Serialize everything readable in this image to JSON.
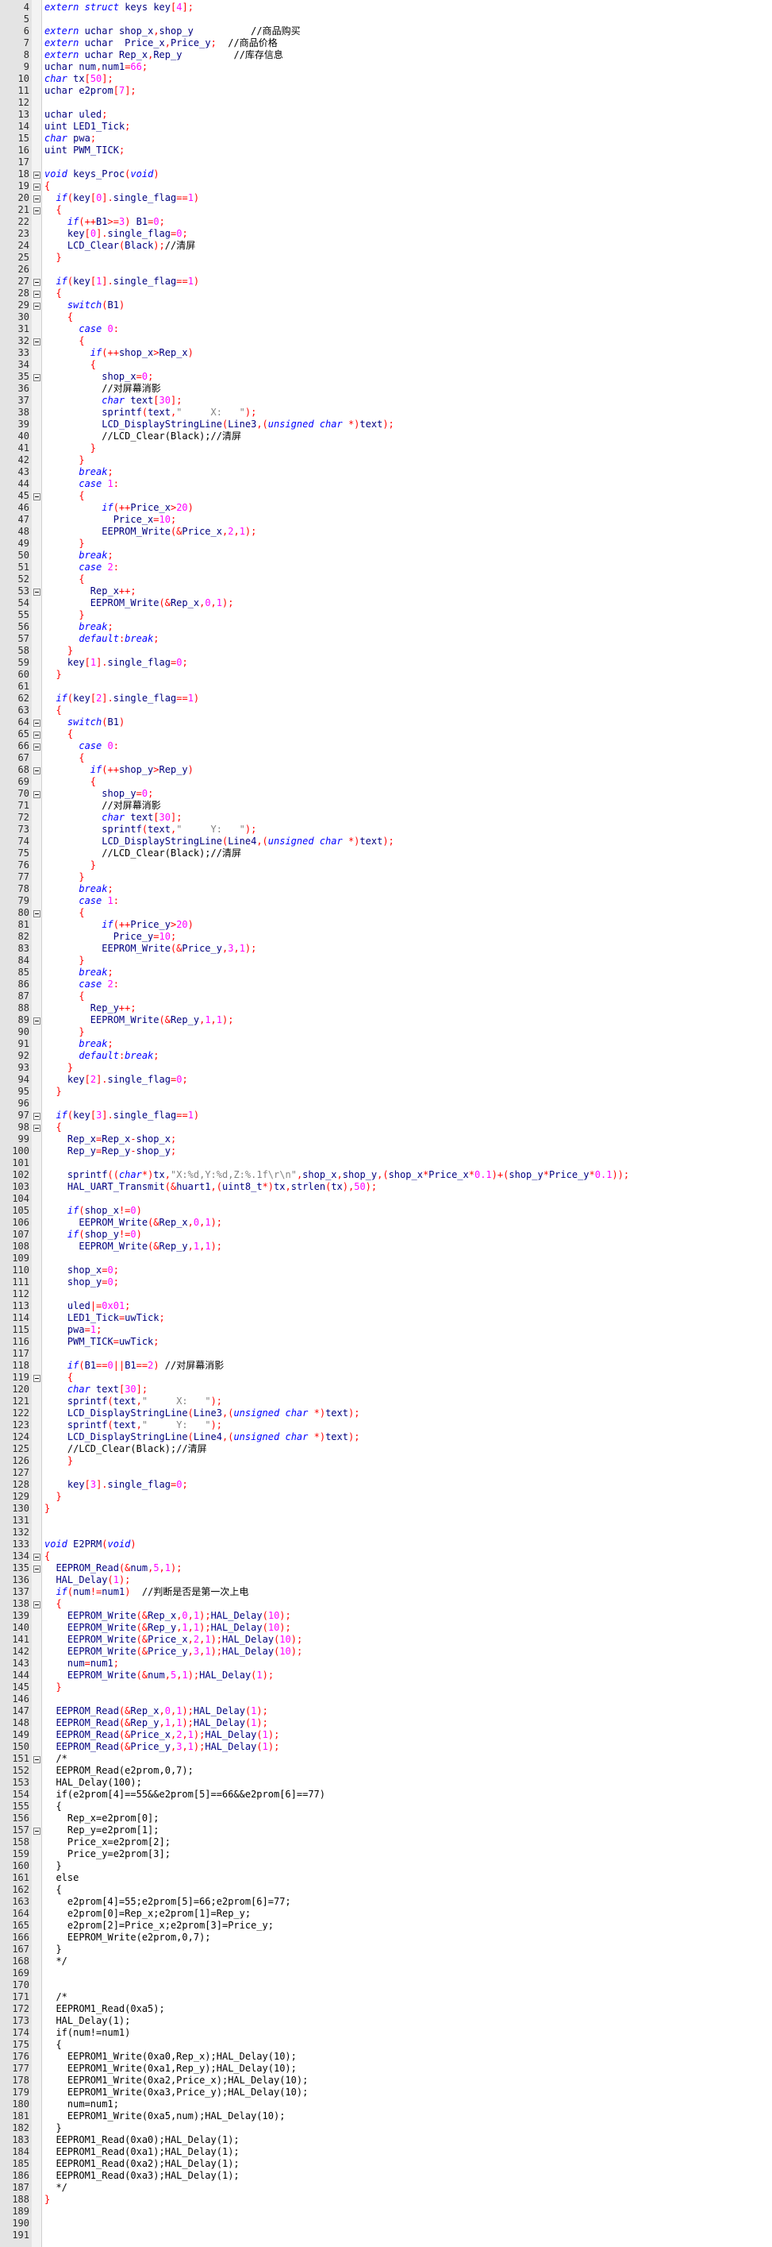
{
  "window": {
    "title": ""
  },
  "editor": {
    "first_line_number": 4,
    "last_line_number": 191,
    "fold_marker_lines": [
      18,
      19,
      20,
      21,
      27,
      28,
      29,
      32,
      35,
      45,
      53,
      64,
      65,
      66,
      68,
      70,
      80,
      89,
      97,
      98,
      119,
      134,
      135,
      138,
      151,
      157
    ]
  },
  "code_lines": [
    {
      "n": 4,
      "t": "extern struct keys key[4];"
    },
    {
      "n": 5,
      "t": ""
    },
    {
      "n": 6,
      "t": "extern uchar shop_x,shop_y          //商品购买"
    },
    {
      "n": 7,
      "t": "extern uchar  Price_x,Price_y;  //商品价格"
    },
    {
      "n": 8,
      "t": "extern uchar Rep_x,Rep_y         //库存信息"
    },
    {
      "n": 9,
      "t": "uchar num,num1=66;"
    },
    {
      "n": 10,
      "t": "char tx[50];"
    },
    {
      "n": 11,
      "t": "uchar e2prom[7];"
    },
    {
      "n": 12,
      "t": ""
    },
    {
      "n": 13,
      "t": "uchar uled;"
    },
    {
      "n": 14,
      "t": "uint LED1_Tick;"
    },
    {
      "n": 15,
      "t": "char pwa;"
    },
    {
      "n": 16,
      "t": "uint PWM_TICK;"
    },
    {
      "n": 17,
      "t": ""
    },
    {
      "n": 18,
      "t": "void keys_Proc(void)"
    },
    {
      "n": 19,
      "t": "{"
    },
    {
      "n": 20,
      "t": "  if(key[0].single_flag==1)"
    },
    {
      "n": 21,
      "t": "  {"
    },
    {
      "n": 22,
      "t": "    if(++B1>=3) B1=0;"
    },
    {
      "n": 23,
      "t": "    key[0].single_flag=0;"
    },
    {
      "n": 24,
      "t": "    LCD_Clear(Black);//清屏"
    },
    {
      "n": 25,
      "t": "  }"
    },
    {
      "n": 26,
      "t": ""
    },
    {
      "n": 27,
      "t": "  if(key[1].single_flag==1)"
    },
    {
      "n": 28,
      "t": "  {"
    },
    {
      "n": 29,
      "t": "    switch(B1)"
    },
    {
      "n": 30,
      "t": "    {"
    },
    {
      "n": 31,
      "t": "      case 0:"
    },
    {
      "n": 32,
      "t": "      {"
    },
    {
      "n": 33,
      "t": "        if(++shop_x>Rep_x)"
    },
    {
      "n": 34,
      "t": "        {"
    },
    {
      "n": 35,
      "t": "          shop_x=0;"
    },
    {
      "n": 36,
      "t": "          //对屏幕消影"
    },
    {
      "n": 37,
      "t": "          char text[30];"
    },
    {
      "n": 38,
      "t": "          sprintf(text,\"     X:   \");"
    },
    {
      "n": 39,
      "t": "          LCD_DisplayStringLine(Line3,(unsigned char *)text);"
    },
    {
      "n": 40,
      "t": "          //LCD_Clear(Black);//清屏"
    },
    {
      "n": 41,
      "t": "        }"
    },
    {
      "n": 42,
      "t": "      }"
    },
    {
      "n": 43,
      "t": "      break;"
    },
    {
      "n": 44,
      "t": "      case 1:"
    },
    {
      "n": 45,
      "t": "      {"
    },
    {
      "n": 46,
      "t": "          if(++Price_x>20)"
    },
    {
      "n": 47,
      "t": "            Price_x=10;"
    },
    {
      "n": 48,
      "t": "          EEPROM_Write(&Price_x,2,1);"
    },
    {
      "n": 49,
      "t": "      }"
    },
    {
      "n": 50,
      "t": "      break;"
    },
    {
      "n": 51,
      "t": "      case 2:"
    },
    {
      "n": 52,
      "t": "      {"
    },
    {
      "n": 53,
      "t": "        Rep_x++;"
    },
    {
      "n": 54,
      "t": "        EEPROM_Write(&Rep_x,0,1);"
    },
    {
      "n": 55,
      "t": "      }"
    },
    {
      "n": 56,
      "t": "      break;"
    },
    {
      "n": 57,
      "t": "      default:break;"
    },
    {
      "n": 58,
      "t": "    }"
    },
    {
      "n": 59,
      "t": "    key[1].single_flag=0;"
    },
    {
      "n": 60,
      "t": "  }"
    },
    {
      "n": 61,
      "t": ""
    },
    {
      "n": 62,
      "t": "  if(key[2].single_flag==1)"
    },
    {
      "n": 63,
      "t": "  {"
    },
    {
      "n": 64,
      "t": "    switch(B1)"
    },
    {
      "n": 65,
      "t": "    {"
    },
    {
      "n": 66,
      "t": "      case 0:"
    },
    {
      "n": 67,
      "t": "      {"
    },
    {
      "n": 68,
      "t": "        if(++shop_y>Rep_y)"
    },
    {
      "n": 69,
      "t": "        {"
    },
    {
      "n": 70,
      "t": "          shop_y=0;"
    },
    {
      "n": 71,
      "t": "          //对屏幕消影"
    },
    {
      "n": 72,
      "t": "          char text[30];"
    },
    {
      "n": 73,
      "t": "          sprintf(text,\"     Y:   \");"
    },
    {
      "n": 74,
      "t": "          LCD_DisplayStringLine(Line4,(unsigned char *)text);"
    },
    {
      "n": 75,
      "t": "          //LCD_Clear(Black);//清屏"
    },
    {
      "n": 76,
      "t": "        }"
    },
    {
      "n": 77,
      "t": "      }"
    },
    {
      "n": 78,
      "t": "      break;"
    },
    {
      "n": 79,
      "t": "      case 1:"
    },
    {
      "n": 80,
      "t": "      {"
    },
    {
      "n": 81,
      "t": "          if(++Price_y>20)"
    },
    {
      "n": 82,
      "t": "            Price_y=10;"
    },
    {
      "n": 83,
      "t": "          EEPROM_Write(&Price_y,3,1);"
    },
    {
      "n": 84,
      "t": "      }"
    },
    {
      "n": 85,
      "t": "      break;"
    },
    {
      "n": 86,
      "t": "      case 2:"
    },
    {
      "n": 87,
      "t": "      {"
    },
    {
      "n": 88,
      "t": "        Rep_y++;"
    },
    {
      "n": 89,
      "t": "        EEPROM_Write(&Rep_y,1,1);"
    },
    {
      "n": 90,
      "t": "      }"
    },
    {
      "n": 91,
      "t": "      break;"
    },
    {
      "n": 92,
      "t": "      default:break;"
    },
    {
      "n": 93,
      "t": "    }"
    },
    {
      "n": 94,
      "t": "    key[2].single_flag=0;"
    },
    {
      "n": 95,
      "t": "  }"
    },
    {
      "n": 96,
      "t": ""
    },
    {
      "n": 97,
      "t": "  if(key[3].single_flag==1)"
    },
    {
      "n": 98,
      "t": "  {"
    },
    {
      "n": 99,
      "t": "    Rep_x=Rep_x-shop_x;"
    },
    {
      "n": 100,
      "t": "    Rep_y=Rep_y-shop_y;"
    },
    {
      "n": 101,
      "t": ""
    },
    {
      "n": 102,
      "t": "    sprintf((char*)tx,\"X:%d,Y:%d,Z:%.1f\\r\\n\",shop_x,shop_y,(shop_x*Price_x*0.1)+(shop_y*Price_y*0.1));"
    },
    {
      "n": 103,
      "t": "    HAL_UART_Transmit(&huart1,(uint8_t*)tx,strlen(tx),50);"
    },
    {
      "n": 104,
      "t": ""
    },
    {
      "n": 105,
      "t": "    if(shop_x!=0)"
    },
    {
      "n": 106,
      "t": "      EEPROM_Write(&Rep_x,0,1);"
    },
    {
      "n": 107,
      "t": "    if(shop_y!=0)"
    },
    {
      "n": 108,
      "t": "      EEPROM_Write(&Rep_y,1,1);"
    },
    {
      "n": 109,
      "t": ""
    },
    {
      "n": 110,
      "t": "    shop_x=0;"
    },
    {
      "n": 111,
      "t": "    shop_y=0;"
    },
    {
      "n": 112,
      "t": ""
    },
    {
      "n": 113,
      "t": "    uled|=0x01;"
    },
    {
      "n": 114,
      "t": "    LED1_Tick=uwTick;"
    },
    {
      "n": 115,
      "t": "    pwa=1;"
    },
    {
      "n": 116,
      "t": "    PWM_TICK=uwTick;"
    },
    {
      "n": 117,
      "t": ""
    },
    {
      "n": 118,
      "t": "    if(B1==0||B1==2) //对屏幕消影"
    },
    {
      "n": 119,
      "t": "    {"
    },
    {
      "n": 120,
      "t": "    char text[30];"
    },
    {
      "n": 121,
      "t": "    sprintf(text,\"     X:   \");"
    },
    {
      "n": 122,
      "t": "    LCD_DisplayStringLine(Line3,(unsigned char *)text);"
    },
    {
      "n": 123,
      "t": "    sprintf(text,\"     Y:   \");"
    },
    {
      "n": 124,
      "t": "    LCD_DisplayStringLine(Line4,(unsigned char *)text);"
    },
    {
      "n": 125,
      "t": "    //LCD_Clear(Black);//清屏"
    },
    {
      "n": 126,
      "t": "    }"
    },
    {
      "n": 127,
      "t": ""
    },
    {
      "n": 128,
      "t": "    key[3].single_flag=0;"
    },
    {
      "n": 129,
      "t": "  }"
    },
    {
      "n": 130,
      "t": "}"
    },
    {
      "n": 131,
      "t": ""
    },
    {
      "n": 132,
      "t": ""
    },
    {
      "n": 133,
      "t": "void E2PRM(void)"
    },
    {
      "n": 134,
      "t": "{"
    },
    {
      "n": 135,
      "t": "  EEPROM_Read(&num,5,1);"
    },
    {
      "n": 136,
      "t": "  HAL_Delay(1);"
    },
    {
      "n": 137,
      "t": "  if(num!=num1)  //判断是否是第一次上电"
    },
    {
      "n": 138,
      "t": "  {"
    },
    {
      "n": 139,
      "t": "    EEPROM_Write(&Rep_x,0,1);HAL_Delay(10);"
    },
    {
      "n": 140,
      "t": "    EEPROM_Write(&Rep_y,1,1);HAL_Delay(10);"
    },
    {
      "n": 141,
      "t": "    EEPROM_Write(&Price_x,2,1);HAL_Delay(10);"
    },
    {
      "n": 142,
      "t": "    EEPROM_Write(&Price_y,3,1);HAL_Delay(10);"
    },
    {
      "n": 143,
      "t": "    num=num1;"
    },
    {
      "n": 144,
      "t": "    EEPROM_Write(&num,5,1);HAL_Delay(1);"
    },
    {
      "n": 145,
      "t": "  }"
    },
    {
      "n": 146,
      "t": ""
    },
    {
      "n": 147,
      "t": "  EEPROM_Read(&Rep_x,0,1);HAL_Delay(1);"
    },
    {
      "n": 148,
      "t": "  EEPROM_Read(&Rep_y,1,1);HAL_Delay(1);"
    },
    {
      "n": 149,
      "t": "  EEPROM_Read(&Price_x,2,1);HAL_Delay(1);"
    },
    {
      "n": 150,
      "t": "  EEPROM_Read(&Price_y,3,1);HAL_Delay(1);"
    },
    {
      "n": 151,
      "t": "  /*"
    },
    {
      "n": 152,
      "t": "  EEPROM_Read(e2prom,0,7);"
    },
    {
      "n": 153,
      "t": "  HAL_Delay(100);"
    },
    {
      "n": 154,
      "t": "  if(e2prom[4]==55&&e2prom[5]==66&&e2prom[6]==77)"
    },
    {
      "n": 155,
      "t": "  {"
    },
    {
      "n": 156,
      "t": "    Rep_x=e2prom[0];"
    },
    {
      "n": 157,
      "t": "    Rep_y=e2prom[1];"
    },
    {
      "n": 158,
      "t": "    Price_x=e2prom[2];"
    },
    {
      "n": 159,
      "t": "    Price_y=e2prom[3];"
    },
    {
      "n": 160,
      "t": "  }"
    },
    {
      "n": 161,
      "t": "  else"
    },
    {
      "n": 162,
      "t": "  {"
    },
    {
      "n": 163,
      "t": "    e2prom[4]=55;e2prom[5]=66;e2prom[6]=77;"
    },
    {
      "n": 164,
      "t": "    e2prom[0]=Rep_x;e2prom[1]=Rep_y;"
    },
    {
      "n": 165,
      "t": "    e2prom[2]=Price_x;e2prom[3]=Price_y;"
    },
    {
      "n": 166,
      "t": "    EEPROM_Write(e2prom,0,7);"
    },
    {
      "n": 167,
      "t": "  }"
    },
    {
      "n": 168,
      "t": "  */"
    },
    {
      "n": 169,
      "t": ""
    },
    {
      "n": 170,
      "t": ""
    },
    {
      "n": 171,
      "t": "  /*"
    },
    {
      "n": 172,
      "t": "  EEPROM1_Read(0xa5);"
    },
    {
      "n": 173,
      "t": "  HAL_Delay(1);"
    },
    {
      "n": 174,
      "t": "  if(num!=num1)"
    },
    {
      "n": 175,
      "t": "  {"
    },
    {
      "n": 176,
      "t": "    EEPROM1_Write(0xa0,Rep_x);HAL_Delay(10);"
    },
    {
      "n": 177,
      "t": "    EEPROM1_Write(0xa1,Rep_y);HAL_Delay(10);"
    },
    {
      "n": 178,
      "t": "    EEPROM1_Write(0xa2,Price_x);HAL_Delay(10);"
    },
    {
      "n": 179,
      "t": "    EEPROM1_Write(0xa3,Price_y);HAL_Delay(10);"
    },
    {
      "n": 180,
      "t": "    num=num1;"
    },
    {
      "n": 181,
      "t": "    EEPROM1_Write(0xa5,num);HAL_Delay(10);"
    },
    {
      "n": 182,
      "t": "  }"
    },
    {
      "n": 183,
      "t": "  EEPROM1_Read(0xa0);HAL_Delay(1);"
    },
    {
      "n": 184,
      "t": "  EEPROM1_Read(0xa1);HAL_Delay(1);"
    },
    {
      "n": 185,
      "t": "  EEPROM1_Read(0xa2);HAL_Delay(1);"
    },
    {
      "n": 186,
      "t": "  EEPROM1_Read(0xa3);HAL_Delay(1);"
    },
    {
      "n": 187,
      "t": "  */"
    },
    {
      "n": 188,
      "t": "}"
    },
    {
      "n": 189,
      "t": ""
    },
    {
      "n": 190,
      "t": ""
    },
    {
      "n": 191,
      "t": ""
    }
  ],
  "colors": {
    "keyword": "#0000ff",
    "identifier": "#000080",
    "string": "#808080",
    "comment": "#000000",
    "number": "#ff00ff",
    "operator": "#ff0000",
    "gutter_bg": "#e4e4e4",
    "editor_bg": "#ffffff"
  }
}
